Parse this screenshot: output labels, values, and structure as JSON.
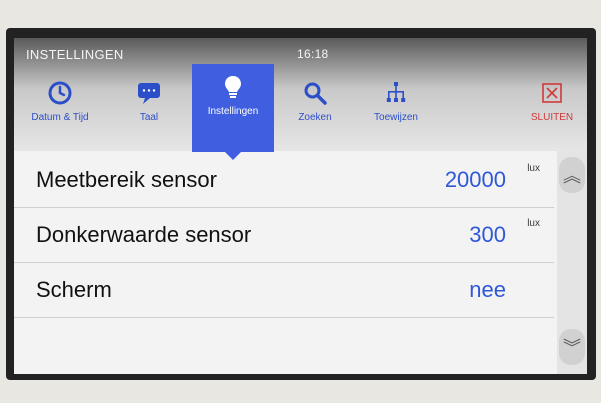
{
  "screen": {
    "title": "INSTELLINGEN",
    "time": "16:18"
  },
  "tabs": [
    {
      "label": "Datum & Tijd",
      "icon": "clock-icon",
      "active": false
    },
    {
      "label": "Taal",
      "icon": "speech-bubble-icon",
      "active": false
    },
    {
      "label": "Instellingen",
      "icon": "lightbulb-icon",
      "active": true
    },
    {
      "label": "Zoeken",
      "icon": "search-icon",
      "active": false
    },
    {
      "label": "Toewijzen",
      "icon": "hierarchy-icon",
      "active": false
    },
    {
      "label": "SLUITEN",
      "icon": "close-icon",
      "active": false
    }
  ],
  "settings": [
    {
      "label": "Meetbereik sensor",
      "value": "20000",
      "unit": "lux"
    },
    {
      "label": "Donkerwaarde sensor",
      "value": "300",
      "unit": "lux"
    },
    {
      "label": "Scherm",
      "value": "nee",
      "unit": ""
    }
  ],
  "colors": {
    "accent": "#3f5fe0",
    "value_text": "#2f58d6",
    "close_text": "#d03a3a"
  }
}
